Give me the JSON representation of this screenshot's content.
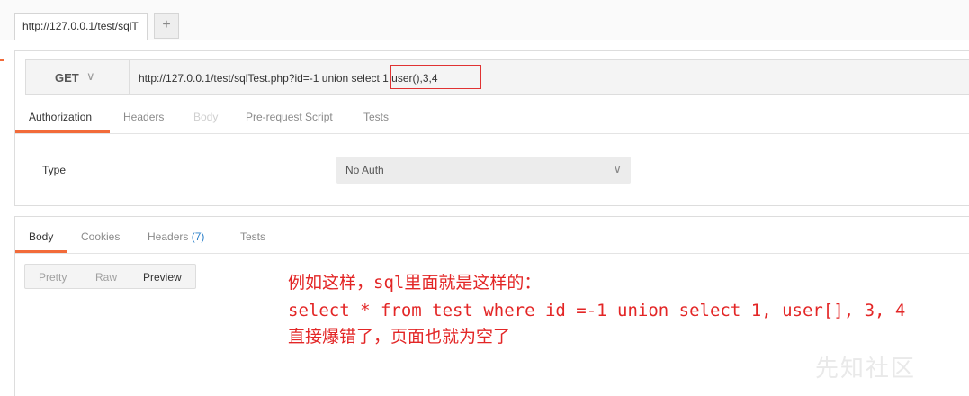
{
  "tabs": {
    "active_tab_label": "http://127.0.0.1/test/sqlT",
    "add_tab_label": "+"
  },
  "request": {
    "method": "GET",
    "url": "http://127.0.0.1/test/sqlTest.php?id=-1 union select 1,user(),3,4",
    "subtabs": [
      "Authorization",
      "Headers",
      "Body",
      "Pre-request Script",
      "Tests"
    ],
    "active_subtab": "Authorization",
    "disabled_subtab": "Body"
  },
  "authorization": {
    "type_label": "Type",
    "type_value": "No Auth"
  },
  "response": {
    "tabs": {
      "body": "Body",
      "cookies": "Cookies",
      "headers": "Headers",
      "headers_count": "(7)",
      "tests": "Tests"
    },
    "view_modes": [
      "Pretty",
      "Raw",
      "Preview"
    ],
    "active_view_mode": "Preview"
  },
  "annotation": {
    "line1": "例如这样，sql里面就是这样的：",
    "line2": "select * from test where id =-1 union select 1, user[], 3, 4",
    "line3": "直接爆错了，页面也就为空了",
    "color": "#e32626"
  },
  "watermark": "先知社区",
  "icons": {
    "method_dropdown": "chevron-down-icon",
    "auth_dropdown": "chevron-down-icon",
    "add_tab": "plus-icon"
  },
  "colors": {
    "accent": "#f26b3a",
    "highlight_box": "#e03232",
    "count_link": "#2a7fc9"
  }
}
